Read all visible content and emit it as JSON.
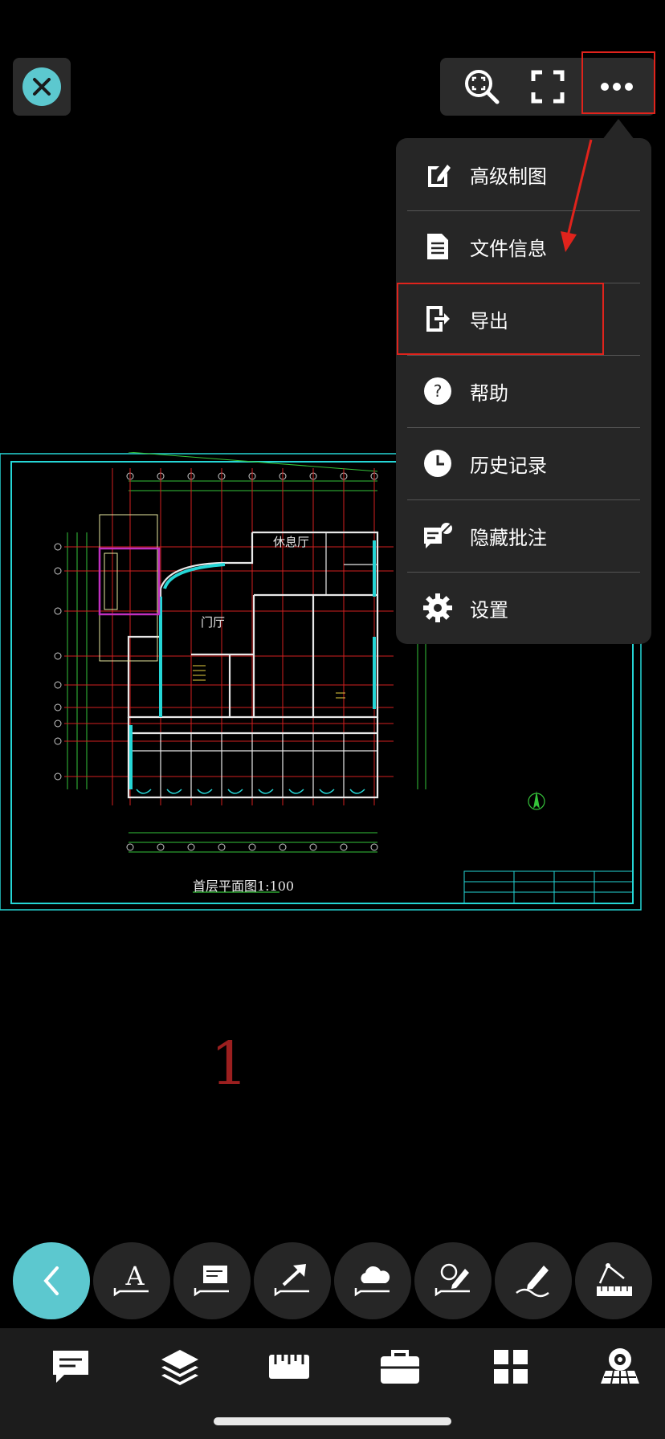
{
  "colors": {
    "accent": "#5cc8cf",
    "highlight_red": "#e0231c",
    "menu_bg": "#262626",
    "cad_cyan": "#25d6d6",
    "cad_red": "#d21f1f",
    "cad_green": "#35c33a"
  },
  "top_bar": {
    "close_icon": "close-icon",
    "tools": [
      "zoom-region-icon",
      "fullscreen-icon",
      "more-icon"
    ]
  },
  "menu": {
    "items": [
      {
        "label": "高级制图",
        "icon": "advanced-drawing-icon"
      },
      {
        "label": "文件信息",
        "icon": "file-info-icon"
      },
      {
        "label": "导出",
        "icon": "export-icon"
      },
      {
        "label": "帮助",
        "icon": "help-icon"
      },
      {
        "label": "历史记录",
        "icon": "history-icon"
      },
      {
        "label": "隐藏批注",
        "icon": "hide-annotations-icon"
      },
      {
        "label": "设置",
        "icon": "settings-icon"
      }
    ]
  },
  "drawing": {
    "room_rest": "休息厅",
    "room_lobby": "门厅",
    "plan_title": "首层平面图1:100"
  },
  "page_number": "1",
  "annotation_tools": [
    "back-icon",
    "text-annotation-icon",
    "comment-icon",
    "arrow-annotation-icon",
    "cloud-annotation-icon",
    "sketch-edit-icon",
    "pen-icon",
    "measure-icon"
  ],
  "bottom_tabs": [
    "comments-icon",
    "layers-icon",
    "ruler-icon",
    "toolbox-icon",
    "grid-icon",
    "viewer-3d-icon"
  ]
}
